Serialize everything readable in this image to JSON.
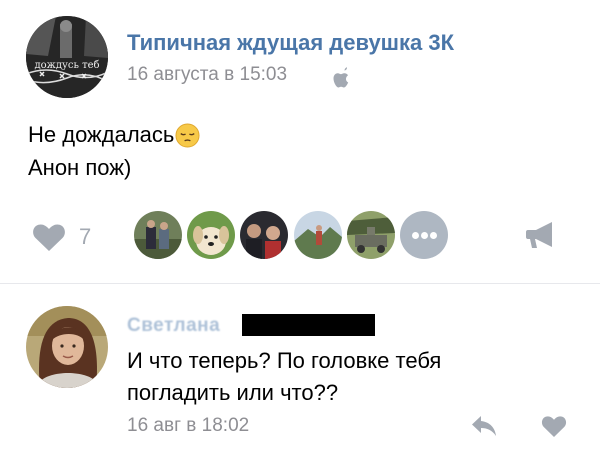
{
  "post": {
    "group_name": "Типичная ждущая девушка 3К",
    "date": "16 августа в 15:03",
    "avatar_caption": "дождусь теб",
    "text_lines": [
      "Не дождалась",
      "Анон пож)"
    ],
    "likes_count": "7"
  },
  "comment": {
    "author": "Светлана",
    "text_lines": [
      "И что теперь? По головке тебя",
      "погладить или что??"
    ],
    "date": "16 авг в 18:02"
  },
  "colors": {
    "link": "#4a76a8",
    "meta": "#8e8e93",
    "icon": "#a3a9b2",
    "divider": "#e7e8ec"
  }
}
